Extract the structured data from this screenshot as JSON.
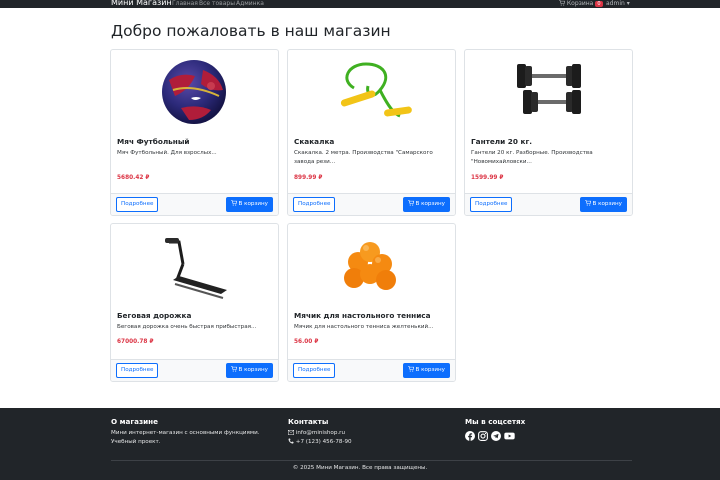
{
  "navbar": {
    "brand": "Мини Магазин",
    "links": [
      "Главная",
      "Все товары",
      "Админка"
    ],
    "cart_label": "Корзина",
    "cart_count": "0",
    "user": "admin ▾"
  },
  "page_title": "Добро пожаловать в наш магазин",
  "products": [
    {
      "title": "Мяч Футбольный",
      "desc": "Мяч Футбольный. Для взрослых...",
      "price": "5680.42 ₽",
      "more_label": "Подробнее",
      "cart_label": "В корзину",
      "image_icon": "soccer-ball-icon"
    },
    {
      "title": "Скакалка",
      "desc": "Скакалка. 2 метра. Производства \"Самарского завода рези...",
      "price": "899.99 ₽",
      "more_label": "Подробнее",
      "cart_label": "В корзину",
      "image_icon": "jump-rope-icon"
    },
    {
      "title": "Гантели 20 кг.",
      "desc": "Гантели 20 кг. Разборные. Производства \"Новомихайловски...",
      "price": "1599.99 ₽",
      "more_label": "Подробнее",
      "cart_label": "В корзину",
      "image_icon": "dumbbells-icon"
    },
    {
      "title": "Беговая дорожка",
      "desc": "Беговая дорожка очень быстрая прибыстрая...",
      "price": "67000.78 ₽",
      "more_label": "Подробнее",
      "cart_label": "В корзину",
      "image_icon": "treadmill-icon"
    },
    {
      "title": "Мячик для настольного тенниса",
      "desc": "Мячик для настольного тенниса желтенький...",
      "price": "56.00 ₽",
      "more_label": "Подробнее",
      "cart_label": "В корзину",
      "image_icon": "ping-pong-balls-icon"
    }
  ],
  "footer": {
    "about_title": "О магазине",
    "about_text": "Мини интернет-магазин с основными функциями. Учебный проект.",
    "contacts_title": "Контакты",
    "email": "info@minishop.ru",
    "phone": "+7 (123) 456-78-90",
    "social_title": "Мы в соцсетях",
    "social_icons": [
      "facebook-icon",
      "instagram-icon",
      "telegram-icon",
      "youtube-icon"
    ],
    "copyright": "© 2025 Мини Магазин. Все права защищены."
  },
  "colors": {
    "primary": "#0d6efd",
    "price": "#dc3545",
    "dark": "#212529"
  }
}
